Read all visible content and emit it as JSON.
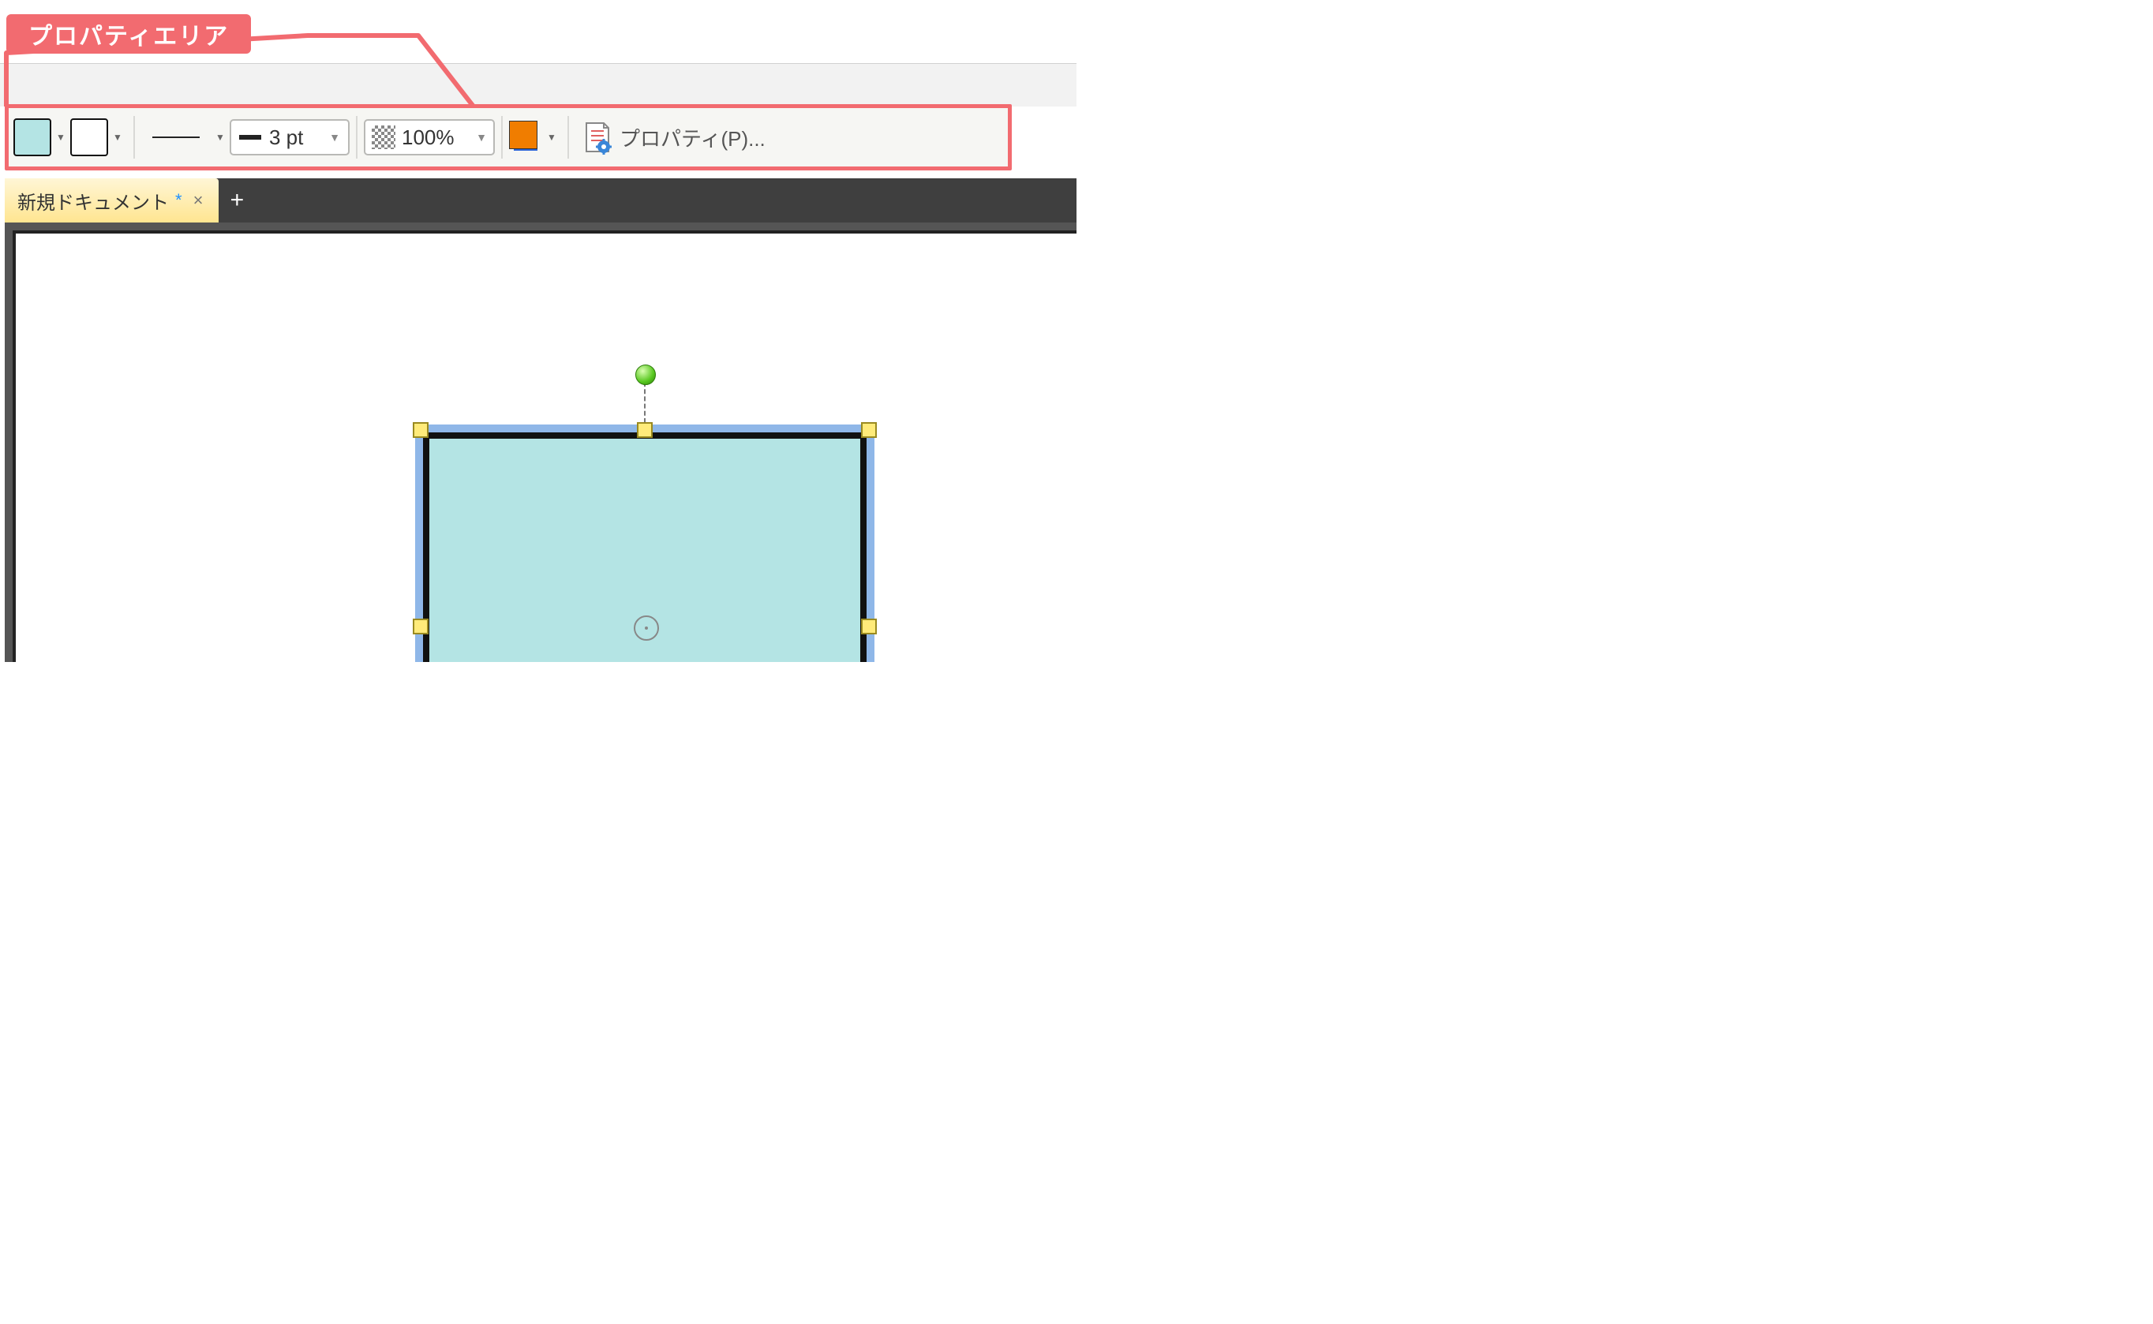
{
  "annotation": {
    "label": "プロパティエリア"
  },
  "toolbar": {
    "fill_color": "#b4e4e4",
    "line_color": "#ffffff",
    "line_weight_label": "3 pt",
    "opacity_label": "100%",
    "layer_front_color": "#f07d00",
    "layer_back_color": "#2a64d8",
    "properties_label": "プロパティ(P)..."
  },
  "tabs": {
    "active": {
      "name": "新規ドキュメント",
      "dirty_marker": "*",
      "close_glyph": "×"
    },
    "add_glyph": "+"
  },
  "canvas": {
    "shape": {
      "type": "rectangle",
      "fill": "#b4e4e4",
      "stroke": "#111111",
      "stroke_weight_pt": 3
    },
    "selection": {
      "rotation_handle": true,
      "handles": 8
    }
  }
}
